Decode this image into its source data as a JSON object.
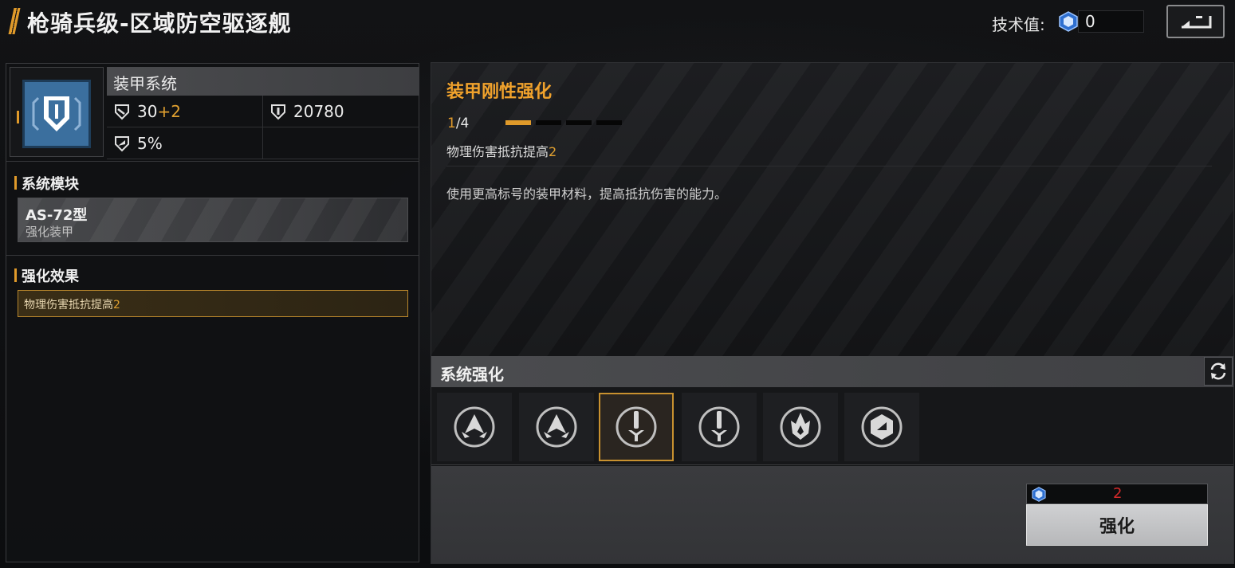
{
  "header": {
    "title": "枪骑兵级-区域防空驱逐舰",
    "tech_label": "技术值:",
    "tech_value": "0",
    "back_icon": "back-arrow-icon"
  },
  "system": {
    "name": "装甲系统",
    "icon": "shield-icon",
    "stats": {
      "armor_value": "30",
      "armor_bonus": "+2",
      "durability": "20780",
      "reduction": "5%"
    }
  },
  "module": {
    "section_title": "系统模块",
    "name": "AS-72型",
    "subtitle": "强化装甲"
  },
  "enhance_effect": {
    "section_title": "强化效果",
    "text": "物理伤害抵抗提高",
    "value": "2"
  },
  "detail": {
    "title": "装甲刚性强化",
    "level_current": "1",
    "level_max": "/4",
    "level_fraction": 0.25,
    "effect_text": "物理伤害抵抗提高",
    "effect_value": "2",
    "description": "使用更高标号的装甲材料，提高抵抗伤害的能力。"
  },
  "enhancement": {
    "title": "系统强化",
    "slots": [
      {
        "icon": "wing-emblem-icon",
        "selected": false
      },
      {
        "icon": "wing-emblem-icon",
        "selected": false
      },
      {
        "icon": "sword-emblem-icon",
        "selected": true
      },
      {
        "icon": "sword-emblem-icon",
        "selected": false
      },
      {
        "icon": "flame-emblem-icon",
        "selected": false
      },
      {
        "icon": "shield-badge-icon",
        "selected": false
      }
    ]
  },
  "action": {
    "cost": "2",
    "button_label": "强化"
  },
  "colors": {
    "accent": "#e09a2a",
    "cost_red": "#d42a2a",
    "system_icon_blue": "#3b6f9e"
  }
}
